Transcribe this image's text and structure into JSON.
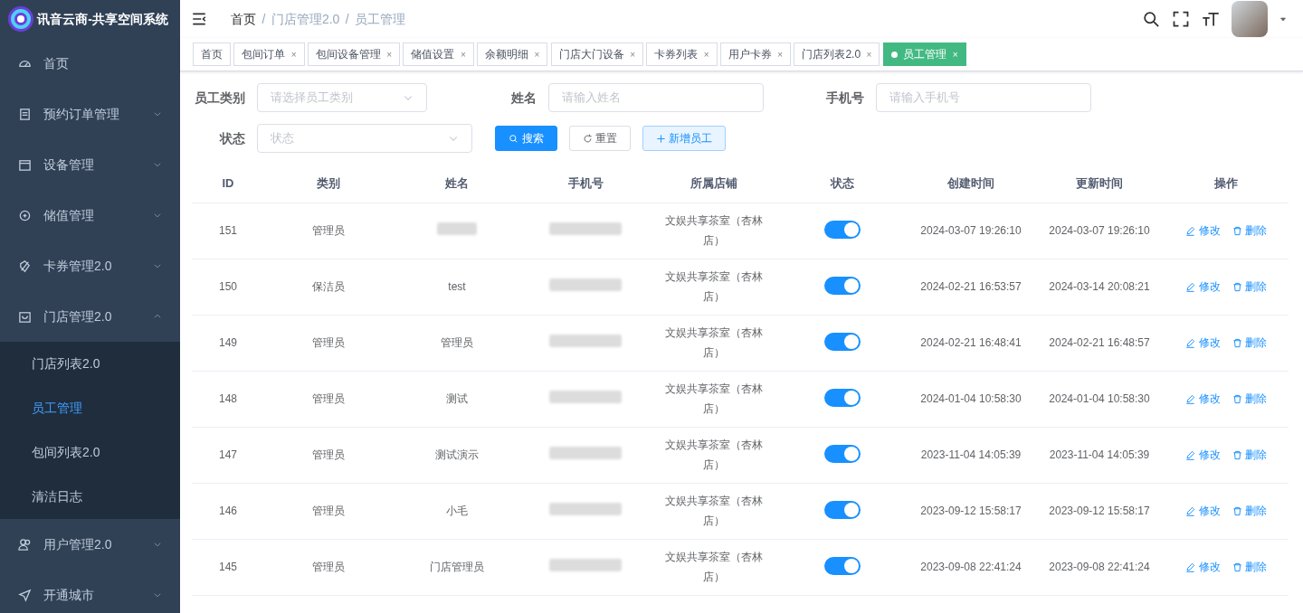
{
  "app": {
    "title": "讯音云商-共享空间系统"
  },
  "sidebar": {
    "items": [
      {
        "label": "首页"
      },
      {
        "label": "预约订单管理",
        "expanded": false
      },
      {
        "label": "设备管理",
        "expanded": false
      },
      {
        "label": "储值管理",
        "expanded": false
      },
      {
        "label": "卡券管理2.0",
        "expanded": false
      },
      {
        "label": "门店管理2.0",
        "expanded": true,
        "children": [
          {
            "label": "门店列表2.0",
            "selected": false
          },
          {
            "label": "员工管理",
            "selected": true
          },
          {
            "label": "包间列表2.0",
            "selected": false
          },
          {
            "label": "清洁日志",
            "selected": false
          }
        ]
      },
      {
        "label": "用户管理2.0",
        "expanded": false
      },
      {
        "label": "开通城市",
        "expanded": false
      }
    ]
  },
  "breadcrumb": [
    {
      "label": "首页"
    },
    {
      "separator": "/",
      "label": "门店管理2.0"
    },
    {
      "separator": "/",
      "label": "员工管理"
    }
  ],
  "tags": [
    {
      "label": "首页",
      "selected": false
    },
    {
      "label": "包间订单",
      "selected": false,
      "close": "×"
    },
    {
      "label": "包间设备管理",
      "selected": false,
      "close": "×"
    },
    {
      "label": "储值设置",
      "selected": false,
      "close": "×"
    },
    {
      "label": "余额明细",
      "selected": false,
      "close": "×"
    },
    {
      "label": "门店大门设备",
      "selected": false,
      "close": "×"
    },
    {
      "label": "卡券列表",
      "selected": false,
      "close": "×"
    },
    {
      "label": "用户卡券",
      "selected": false,
      "close": "×"
    },
    {
      "label": "门店列表2.0",
      "selected": false,
      "close": "×"
    },
    {
      "label": "员工管理",
      "selected": true,
      "close": "×"
    }
  ],
  "filters": [
    {
      "label": "员工类别",
      "kind": "select",
      "placeholder": "请选择员工类别"
    },
    {
      "label": "姓名",
      "kind": "input",
      "placeholder": "请输入姓名"
    },
    {
      "label": "手机号",
      "kind": "input",
      "placeholder": "请输入手机号"
    },
    {
      "label": "状态",
      "kind": "select",
      "placeholder": "状态"
    }
  ],
  "actions": [
    {
      "label": "搜索",
      "kind": "primary"
    },
    {
      "label": "重置",
      "kind": "default"
    },
    {
      "label": "新增员工",
      "kind": "plain"
    }
  ],
  "table": {
    "columns": [
      "ID",
      "类别",
      "姓名",
      "手机号",
      "所属店铺",
      "状态",
      "创建时间",
      "更新时间",
      "操作"
    ],
    "rows": [
      {
        "id": "151",
        "type": "管理员",
        "name_blurred": true,
        "store": "文娱共享茶室（杏林店）",
        "on": true,
        "created": "2024-03-07 19:26:10",
        "updated": "2024-03-07 19:26:10",
        "actions": [
          "修改",
          "删除"
        ]
      },
      {
        "id": "150",
        "type": "保洁员",
        "name": "test",
        "store": "文娱共享茶室（杏林店）",
        "on": true,
        "created": "2024-02-21 16:53:57",
        "updated": "2024-03-14 20:08:21",
        "actions": [
          "修改",
          "删除"
        ]
      },
      {
        "id": "149",
        "type": "管理员",
        "name": "管理员",
        "store": "文娱共享茶室（杏林店）",
        "on": true,
        "created": "2024-02-21 16:48:41",
        "updated": "2024-02-21 16:48:57",
        "actions": [
          "修改",
          "删除"
        ]
      },
      {
        "id": "148",
        "type": "管理员",
        "name": "测试",
        "store": "文娱共享茶室（杏林店）",
        "on": true,
        "created": "2024-01-04 10:58:30",
        "updated": "2024-01-04 10:58:30",
        "actions": [
          "修改",
          "删除"
        ]
      },
      {
        "id": "147",
        "type": "管理员",
        "name": "测试演示",
        "store": "文娱共享茶室（杏林店）",
        "on": true,
        "created": "2023-11-04 14:05:39",
        "updated": "2023-11-04 14:05:39",
        "actions": [
          "修改",
          "删除"
        ]
      },
      {
        "id": "146",
        "type": "管理员",
        "name": "小毛",
        "store": "文娱共享茶室（杏林店）",
        "on": true,
        "created": "2023-09-12 15:58:17",
        "updated": "2023-09-12 15:58:17",
        "actions": [
          "修改",
          "删除"
        ]
      },
      {
        "id": "145",
        "type": "管理员",
        "name": "门店管理员",
        "store": "文娱共享茶室（杏林店）",
        "on": true,
        "created": "2023-09-08 22:41:24",
        "updated": "2023-09-08 22:41:24",
        "actions": [
          "修改",
          "删除"
        ]
      }
    ]
  }
}
